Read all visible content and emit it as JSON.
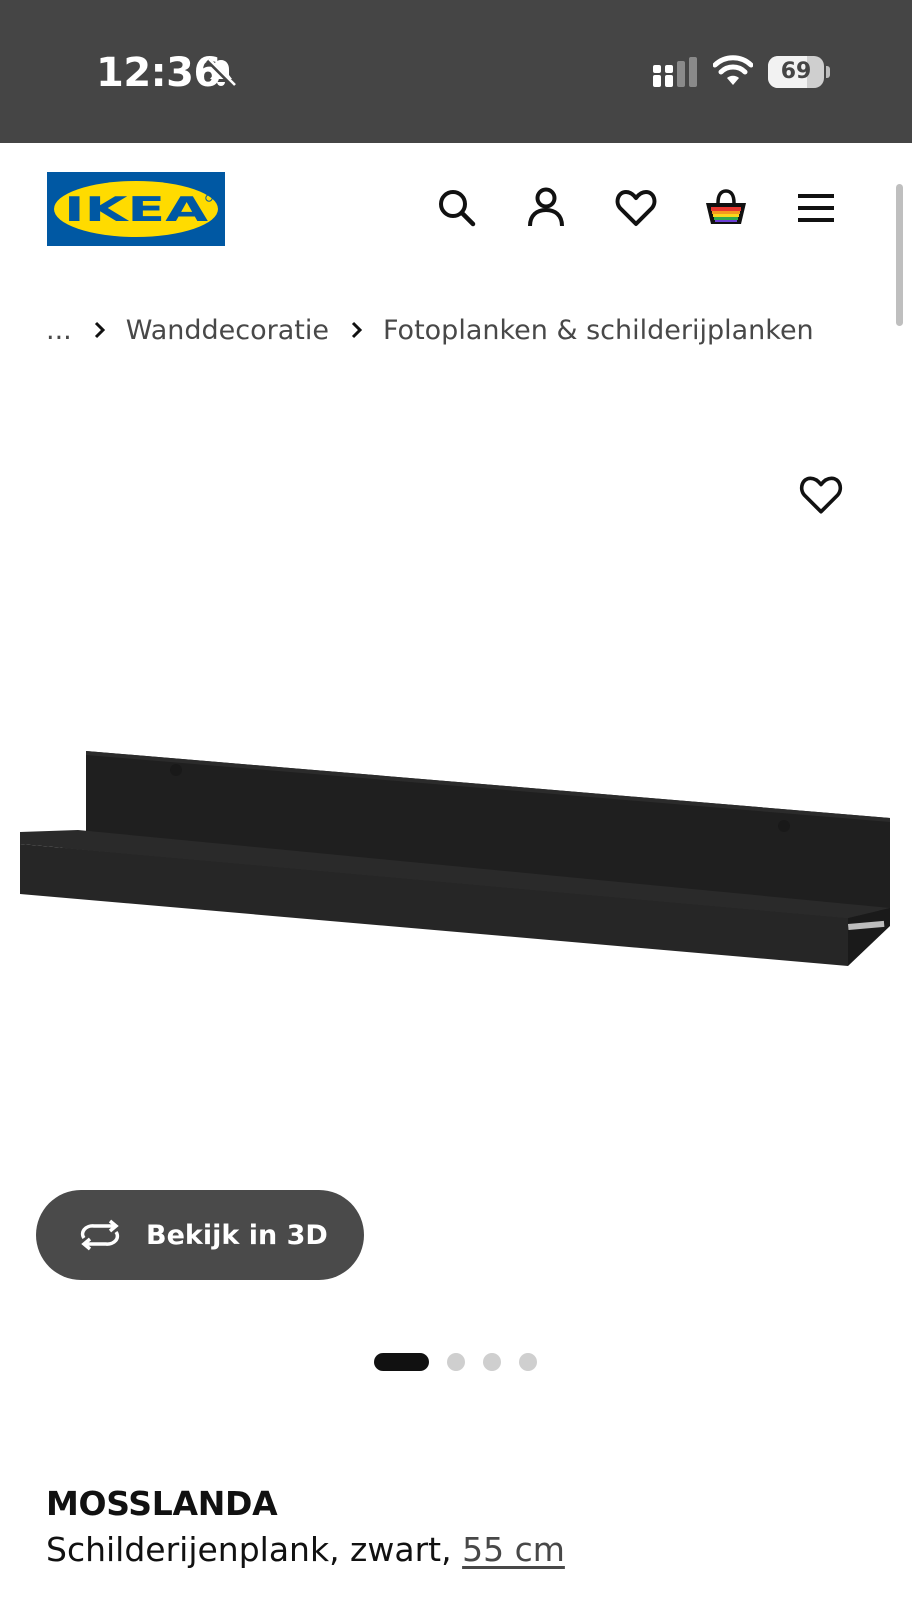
{
  "status_bar": {
    "time": "12:36",
    "battery": "69",
    "battery_level": 0.69
  },
  "header": {
    "logo_text": "IKEA",
    "icons": [
      "search-icon",
      "account-icon",
      "favourites-icon",
      "basket-icon",
      "menu-icon"
    ]
  },
  "breadcrumb": {
    "ellipsis": "...",
    "items": [
      "Wanddecoratie",
      "Fotoplanken & schilderijplanken"
    ]
  },
  "gallery": {
    "view_3d_label": "Bekijk in 3D",
    "slide_count": 4,
    "active_slide": 1
  },
  "product": {
    "name": "MOSSLANDA",
    "description": "Schilderijenplank, zwart,",
    "size": "55 cm"
  },
  "colors": {
    "status_bar_bg": "#454545",
    "ikea_blue": "#0058A3",
    "ikea_yellow": "#FFDB00",
    "button_bg": "#4a4a4a",
    "text": "#111111",
    "muted_text": "#484848"
  }
}
